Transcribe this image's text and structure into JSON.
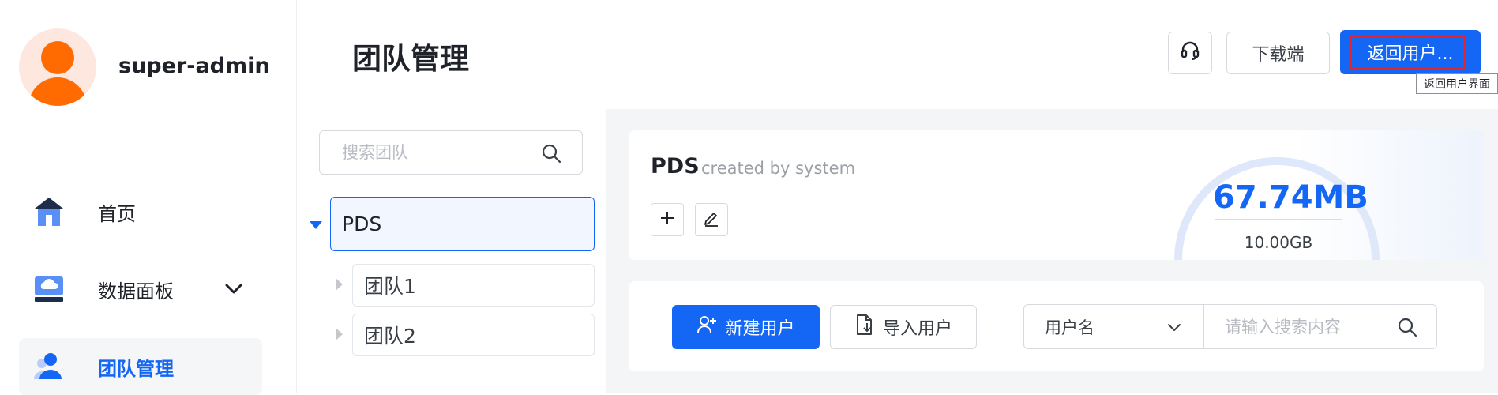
{
  "sidebar": {
    "username": "super-admin",
    "items": [
      {
        "label": "首页",
        "icon": "home-icon"
      },
      {
        "label": "数据面板",
        "icon": "data-panel-icon"
      },
      {
        "label": "团队管理",
        "icon": "team-icon"
      }
    ]
  },
  "header": {
    "title": "团队管理",
    "download_label": "下载端",
    "back_label": "返回用户...",
    "back_tooltip": "返回用户界面"
  },
  "tree": {
    "search_placeholder": "搜索团队",
    "root": "PDS",
    "children": [
      "团队1",
      "团队2"
    ]
  },
  "info": {
    "team_name": "PDS",
    "created_by": "created by system",
    "used": "67.74MB",
    "total": "10.00GB"
  },
  "actions": {
    "new_user": "新建用户",
    "import_users": "导入用户",
    "filter_field": "用户名",
    "search_placeholder": "请输入搜索内容"
  },
  "colors": {
    "primary": "#1467f5",
    "avatar": "#ff6b00",
    "focus_ring": "#e3242b"
  }
}
